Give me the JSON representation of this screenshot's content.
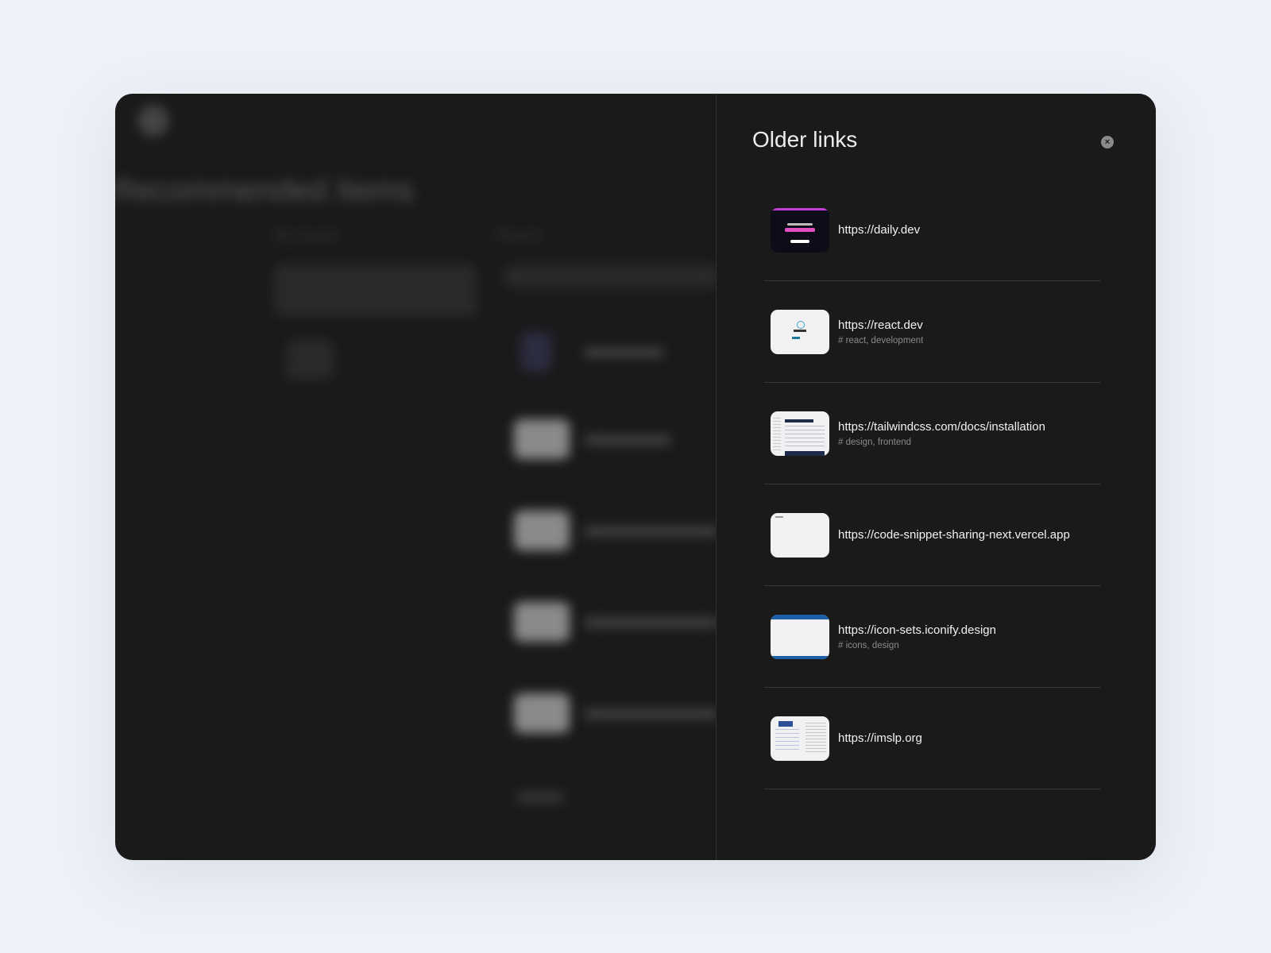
{
  "background_app": {
    "title": "Recommended Items",
    "left_label": "My boards",
    "right_label": "Recent"
  },
  "panel": {
    "title": "Older links",
    "close_icon": "×",
    "links": [
      {
        "url": "https://daily.dev",
        "tags": "",
        "thumb": "daily"
      },
      {
        "url": "https://react.dev",
        "tags": "# react, development",
        "thumb": "react"
      },
      {
        "url": "https://tailwindcss.com/docs/installation",
        "tags": "# design, frontend",
        "thumb": "tw"
      },
      {
        "url": "https://code-snippet-sharing-next.vercel.app",
        "tags": "",
        "thumb": "code"
      },
      {
        "url": "https://icon-sets.iconify.design",
        "tags": "# icons, design",
        "thumb": "icon"
      },
      {
        "url": "https://imslp.org",
        "tags": "",
        "thumb": "imslp"
      }
    ]
  }
}
